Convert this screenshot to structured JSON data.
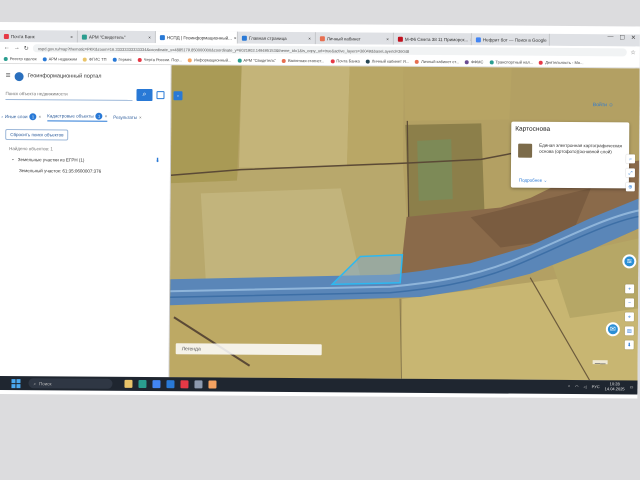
{
  "browser": {
    "tabs": [
      {
        "label": "Почта Банк",
        "color": "#e63946"
      },
      {
        "label": "АРМ \"Свидетель\"",
        "color": "#2a9d8f"
      },
      {
        "label": "НСПД | Геоинформационный...",
        "color": "#2979d6",
        "active": true
      },
      {
        "label": "Главная страница",
        "color": "#2979d6"
      },
      {
        "label": "Личный кабинет",
        "color": "#e76f51"
      },
      {
        "label": "М-Ф6 Смета 38 11 Приморск...",
        "color": "#c1121f"
      },
      {
        "label": "Нефрит бот — Поиск в Google",
        "color": "#4285f4"
      }
    ],
    "window_controls": [
      "—",
      "☐",
      "✕"
    ],
    "url": "nspd.gov.ru/map?thematic=PKK&zoom=16.33333333333334&coordinate_x=4885179.850000000&coordinate_y=6021903.149495153&theme_id=1&is_copy_url=true&active_layers=36049&baseLayerId=36048"
  },
  "bookmarks": [
    {
      "label": "Реестр сделок",
      "color": "#2a9d8f"
    },
    {
      "label": "АРМ недвижим",
      "color": "#2979d6"
    },
    {
      "label": "ФГИС ТП",
      "color": "#e9c46a"
    },
    {
      "label": "Гермес",
      "color": "#2979d6"
    },
    {
      "label": "Черта России. Пор...",
      "color": "#e63946"
    },
    {
      "label": "Информационный...",
      "color": "#f4a261"
    },
    {
      "label": "АРМ \"Свидетель\"",
      "color": "#2a9d8f"
    },
    {
      "label": "Валютная статист...",
      "color": "#e76f51"
    },
    {
      "label": "Почта Банка",
      "color": "#e63946"
    },
    {
      "label": "Личный кабинет Я...",
      "color": "#264653"
    },
    {
      "label": "Личный кабинет ст...",
      "color": "#e76f51"
    },
    {
      "label": "ФФМС",
      "color": "#6a4c93"
    },
    {
      "label": "Транспортный нал...",
      "color": "#2a9d8f"
    },
    {
      "label": "Деятельность - Мо...",
      "color": "#e63946"
    }
  ],
  "sidebar": {
    "portal_title": "Геоинформационный портал",
    "search_placeholder": "Поиск объекта недвижимости",
    "search_icon": "⌕",
    "filters": [
      {
        "label": "Иные слои",
        "count": "1"
      },
      {
        "label": "Кадастровые объекты",
        "count": "1"
      },
      {
        "label": "Результаты"
      }
    ],
    "filter_remove": "×",
    "filter_more": "›",
    "clear_button": "Сбросить поиск объектов",
    "found_label": "Найдено объектов: 1",
    "result_group": "Земельные участки из ЕГРН (1)",
    "download_icon": "⬇",
    "result_item": "Земельный участок: 61:35:0600007:376"
  },
  "map": {
    "collapse_icon": "›",
    "login": "Войти",
    "popup": {
      "title": "Картоснова",
      "description": "Единая электронная картографическая основа (ортофото)(основной слой)",
      "link": "Подробнее"
    },
    "legend": "Легенда",
    "tool_icons": [
      "⌕",
      "⤢",
      "⊕"
    ],
    "side_icons": [
      "+",
      "−",
      "⌖",
      "▤",
      "⬇"
    ]
  },
  "taskbar": {
    "search_placeholder": "Поиск",
    "language": "РУС",
    "time": "10:28",
    "date": "14.04.2025",
    "icon_colors": [
      "#e9c46a",
      "#2a9d8f",
      "#4285f4",
      "#2979d6",
      "#e63946",
      "#8d99ae",
      "#f4a261"
    ]
  }
}
